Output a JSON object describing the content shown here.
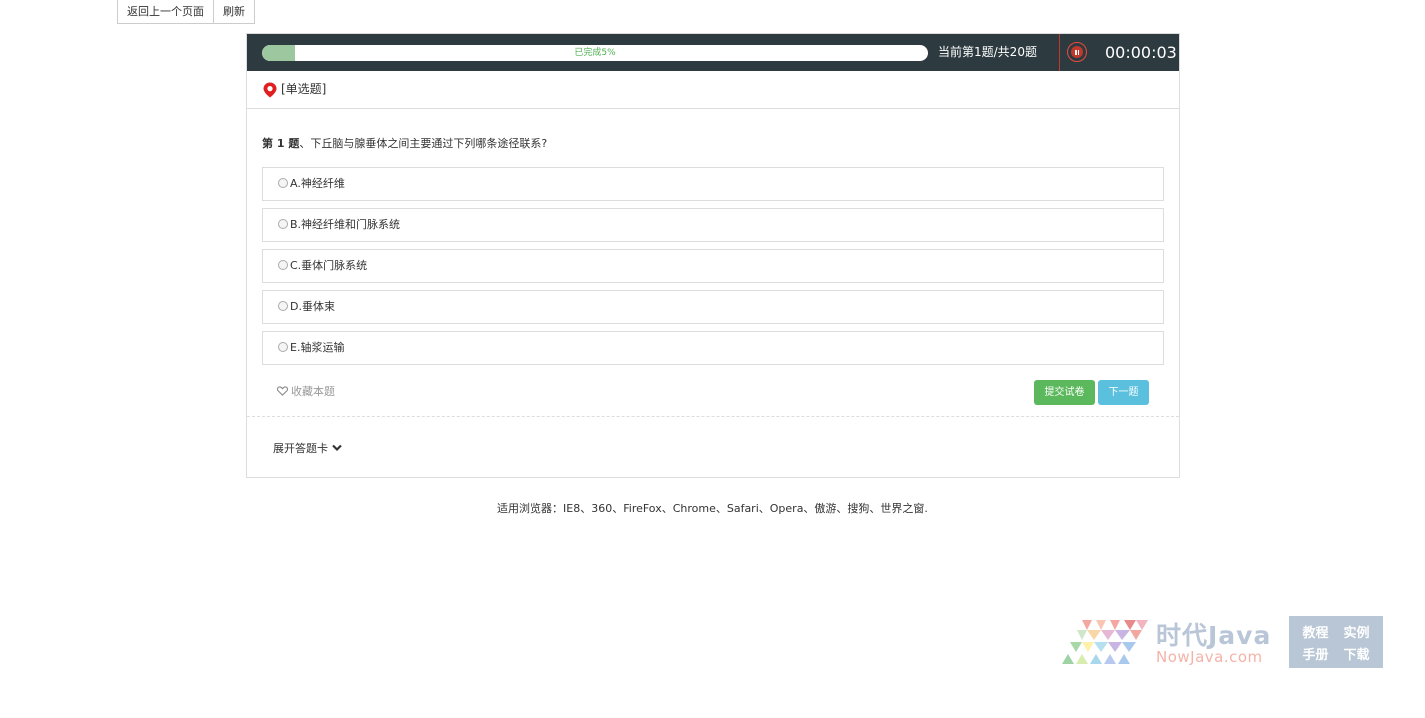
{
  "nav": {
    "back_label": "返回上一个页面",
    "refresh_label": "刷新"
  },
  "exam": {
    "progress_text": "已完成5%",
    "progress_fraction": 0.05,
    "question_counter": "当前第1题/共20题",
    "timer": "00:00:03",
    "question_type": "[单选题]",
    "question_number": "第 1 题",
    "question_text": "、下丘脑与腺垂体之间主要通过下列哪条途径联系?",
    "options": [
      {
        "label": "A.神经纤维"
      },
      {
        "label": "B.神经纤维和门脉系统"
      },
      {
        "label": "C.垂体门脉系统"
      },
      {
        "label": "D.垂体束"
      },
      {
        "label": "E.轴浆运输"
      }
    ],
    "favorite_label": "收藏本题",
    "submit_label": "提交试卷",
    "next_label": "下一题",
    "expand_label": "展开答题卡"
  },
  "footer": {
    "browsers_text": "适用浏览器：IE8、360、FireFox、Chrome、Safari、Opera、傲游、搜狗、世界之窗."
  },
  "watermark": {
    "title": "时代Java",
    "subtitle": "NowJava.com",
    "box_items": [
      "教程",
      "实例",
      "手册",
      "下载"
    ]
  },
  "colors": {
    "header_bg": "#2d3a40",
    "progress_fill": "#9dc89f",
    "submit_green": "#5cb85c",
    "next_blue": "#5bc0de",
    "pin_red": "#e02020"
  }
}
